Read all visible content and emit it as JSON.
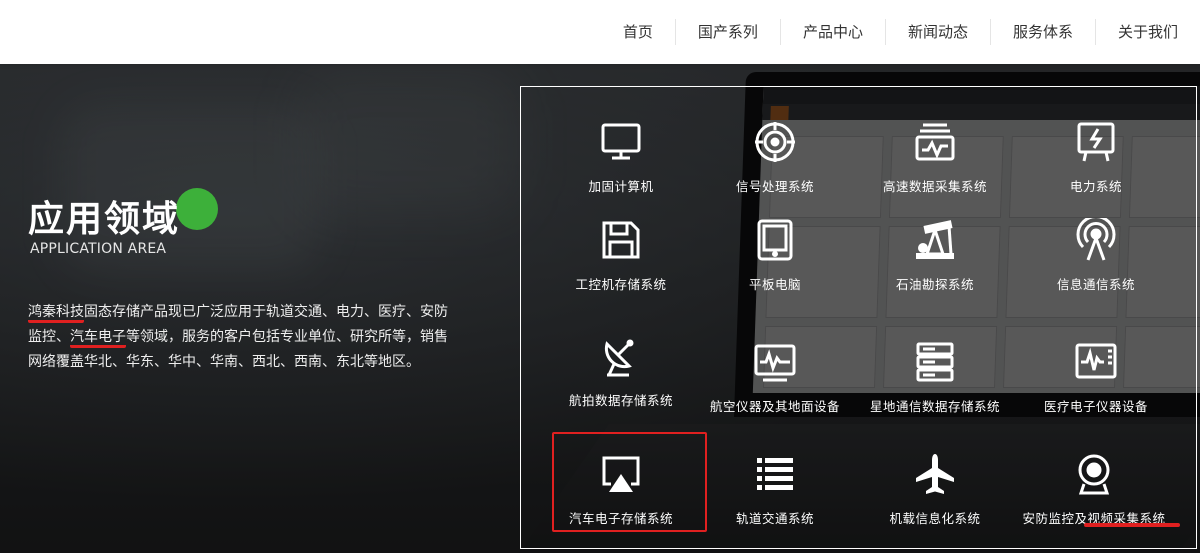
{
  "nav": {
    "items": [
      "首页",
      "国产系列",
      "产品中心",
      "新闻动态",
      "服务体系",
      "关于我们"
    ]
  },
  "hero": {
    "title": "应用领域",
    "subtitle": "APPLICATION AREA",
    "desc": {
      "company": "鸿秦科技",
      "part1": "固态存储产品现已广泛应用于轨道交通、电力、医疗、安防监控、",
      "auto": "汽车电子",
      "part2": "等领域，服务的客户包括专业单位、研究所等，销售网络覆盖华北、华东、华中、华南、西北、西南、东北等地区。"
    }
  },
  "areas": [
    {
      "label": "加固计算机",
      "icon": "monitor-icon"
    },
    {
      "label": "信号处理系统",
      "icon": "target-icon"
    },
    {
      "label": "高速数据采集系统",
      "icon": "data-waveform-icon"
    },
    {
      "label": "电力系统",
      "icon": "power-board-icon"
    },
    {
      "label": "工控机存储系统",
      "icon": "floppy-disk-icon"
    },
    {
      "label": "平板电脑",
      "icon": "tablet-icon"
    },
    {
      "label": "石油勘探系统",
      "icon": "oil-pump-icon"
    },
    {
      "label": "信息通信系统",
      "icon": "antenna-icon"
    },
    {
      "label": "航拍数据存储系统",
      "icon": "satellite-dish-icon"
    },
    {
      "label": "航空仪器及其地面设备",
      "icon": "oscilloscope-icon"
    },
    {
      "label": "星地通信数据存储系统",
      "icon": "server-rack-icon"
    },
    {
      "label": "医疗电子仪器设备",
      "icon": "medical-monitor-icon"
    },
    {
      "label": "汽车电子存储系统",
      "icon": "airplay-icon"
    },
    {
      "label": "轨道交通系统",
      "icon": "list-icon"
    },
    {
      "label": "机载信息化系统",
      "icon": "airplane-icon"
    },
    {
      "label": "安防监控及视频采集系统",
      "icon": "webcam-icon"
    }
  ]
}
